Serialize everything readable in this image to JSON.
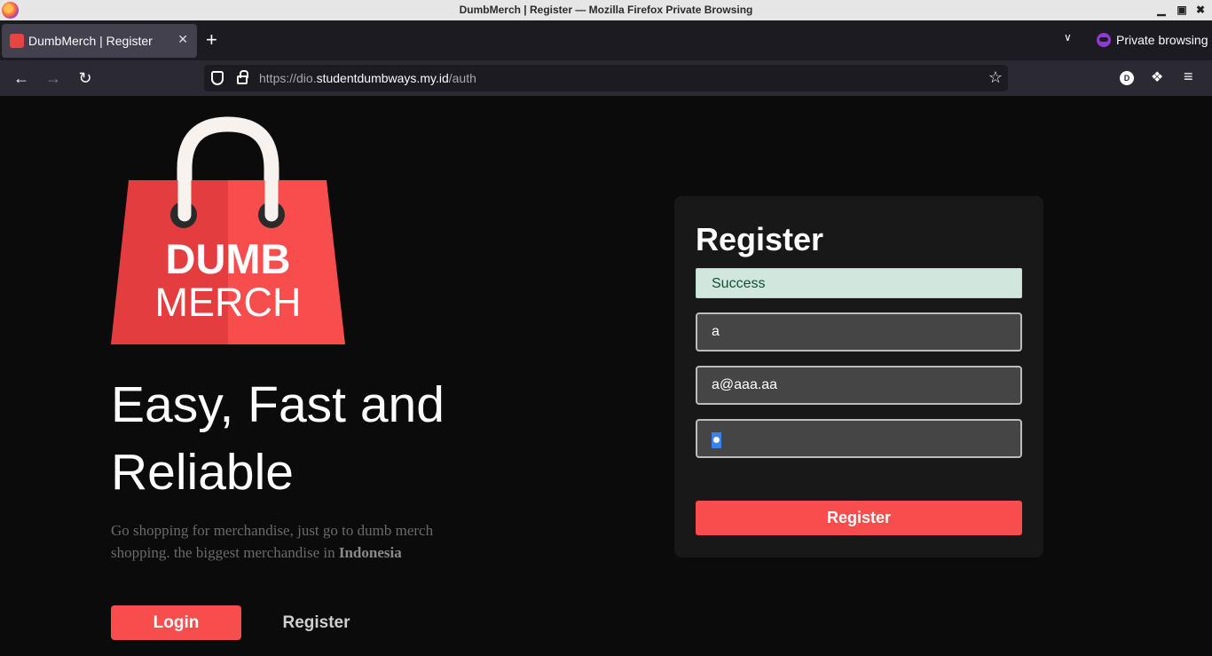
{
  "window": {
    "title": "DumbMerch | Register — Mozilla Firefox Private Browsing"
  },
  "tabs": [
    {
      "label": "DumbMerch | Register"
    }
  ],
  "browser": {
    "private_label": "Private browsing",
    "url_prefix": "https://dio.",
    "url_domain": "studentdumbways.my.id",
    "url_path": "/auth",
    "account_initial": "D"
  },
  "logo": {
    "line1": "DUMB",
    "line2": "MERCH"
  },
  "hero": {
    "headline": "Easy, Fast and Reliable",
    "desc_main": "Go shopping for merchandise, just go to dumb merch shopping. the biggest merchandise in ",
    "desc_bold": "Indonesia"
  },
  "actions": {
    "login_label": "Login",
    "register_label": "Register"
  },
  "register_form": {
    "title": "Register",
    "alert": "Success",
    "name_value": "a",
    "email_value": "a@aaa.aa",
    "submit_label": "Register"
  },
  "colors": {
    "brand_red": "#f74d4d",
    "background": "#0b0b0b",
    "card": "#181818",
    "success_bg": "#d1e7dd"
  }
}
